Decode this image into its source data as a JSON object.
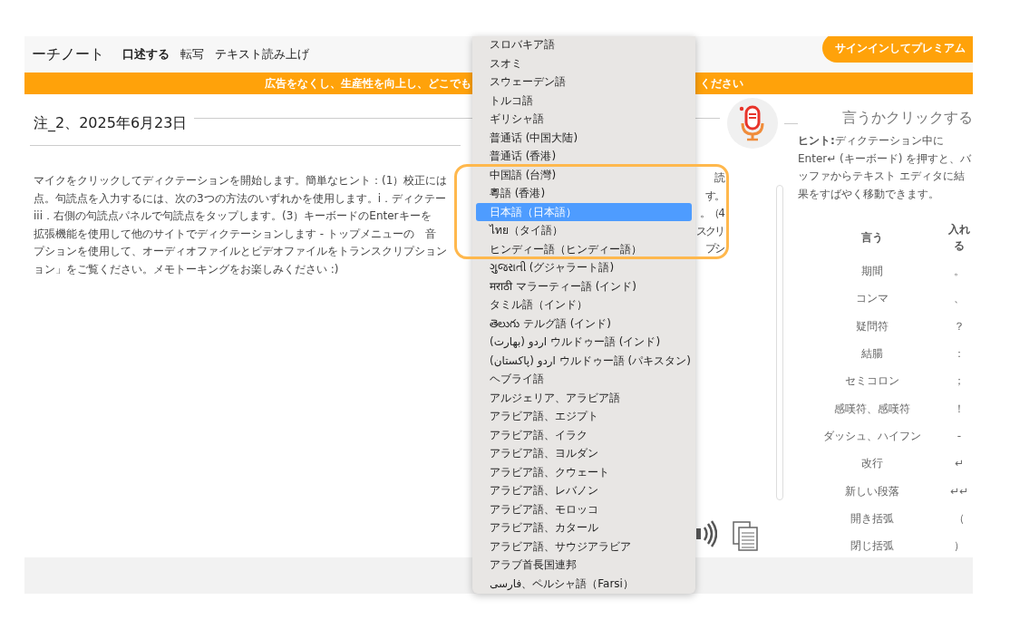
{
  "app_nav": {
    "brand": "ーチノート",
    "tabs": [
      {
        "label": "口述する",
        "selected": true
      },
      {
        "label": "転写",
        "selected": false
      },
      {
        "label": "テキスト読み上げ",
        "selected": false
      }
    ],
    "signin_button": "サインインしてプレミアム"
  },
  "banner": {
    "text_left": "広告をなくし、生産性を向上し、どこでも",
    "text_right": "ください"
  },
  "note": {
    "title": "注_2、2025年6月23日",
    "text_lines": [
      {
        "left": "マイクをクリックしてディクテーションを開始します。簡単なヒント：(1）校正には",
        "right": "読"
      },
      {
        "left": "点。句読点を入力するには、次の3つの方法のいずれかを使用します。i．ディクテー",
        "right": "す。"
      },
      {
        "left": "iii．右側の句読点パネルで句読点をタップします。(3）キーボードのEnterキーを",
        "right": "。（4"
      },
      {
        "left": "拡張機能を使用して他のサイトでディクテーションします - トップメニューの　音",
        "right": "スクリ"
      },
      {
        "left": "プションを使用して、オーディオファイルとビデオファイルをトランスクリプション",
        "right": "プシ"
      },
      {
        "left": "ョン」をご覧ください。メモトーキングをお楽しみください :)"
      }
    ]
  },
  "dictation_panel": {
    "heading": "言うかクリックする",
    "hint": "**ヒント:**ディクテーション中にEnter↵ (キーボード) を押すと、バッファからテキスト エディタに結果をすばやく移動できます。",
    "table": {
      "columns": [
        "言う",
        "入れる"
      ],
      "rows": [
        [
          "期間",
          "。"
        ],
        [
          "コンマ",
          "、"
        ],
        [
          "疑問符",
          "？"
        ],
        [
          "結腸",
          "："
        ],
        [
          "セミコロン",
          "；"
        ],
        [
          "感嘆符、感嘆符",
          "！"
        ],
        [
          "ダッシュ、ハイフン",
          "-"
        ],
        [
          "改行",
          "↵"
        ],
        [
          "新しい段落",
          "↵↵"
        ],
        [
          "開き括弧",
          "（"
        ],
        [
          "閉じ括弧",
          "）"
        ]
      ]
    }
  },
  "language_menu": {
    "items": [
      {
        "label": "スロバキア語",
        "selected": false
      },
      {
        "label": "スオミ",
        "selected": false
      },
      {
        "label": "スウェーデン語",
        "selected": false
      },
      {
        "label": "トルコ語",
        "selected": false
      },
      {
        "label": "ギリシャ語",
        "selected": false
      },
      {
        "label": "普通话 (中国大陆)",
        "selected": false
      },
      {
        "label": "普通话 (香港)",
        "selected": false
      },
      {
        "label": "中国語 (台灣)",
        "selected": false
      },
      {
        "label": "粵語 (香港)",
        "selected": false
      },
      {
        "label": "日本語（日本語）",
        "selected": true
      },
      {
        "label": "ไทย（タイ語）",
        "selected": false
      },
      {
        "label": "ヒンディー語（ヒンディー語）",
        "selected": false
      },
      {
        "label": "ગુજરાતી (グジャラート語)",
        "selected": false
      },
      {
        "label": "मराठी マラーティー語 (インド)",
        "selected": false
      },
      {
        "label": "タミル語（インド）",
        "selected": false
      },
      {
        "label": "తెలుగు テルグ語 (インド)",
        "selected": false
      },
      {
        "label": "اردو (بھارت) ウルドゥー語 (インド)",
        "selected": false
      },
      {
        "label": "اردو (پاکستان) ウルドゥー語 (パキスタン)",
        "selected": false
      },
      {
        "label": "ヘブライ語",
        "selected": false
      },
      {
        "label": "アルジェリア、アラビア語",
        "selected": false
      },
      {
        "label": "アラビア語、エジプト",
        "selected": false
      },
      {
        "label": "アラビア語、イラク",
        "selected": false
      },
      {
        "label": "アラビア語、ヨルダン",
        "selected": false
      },
      {
        "label": "アラビア語、クウェート",
        "selected": false
      },
      {
        "label": "アラビア語、レバノン",
        "selected": false
      },
      {
        "label": "アラビア語、モロッコ",
        "selected": false
      },
      {
        "label": "アラビア語、カタール",
        "selected": false
      },
      {
        "label": "アラビア語、サウジアラビア",
        "selected": false
      },
      {
        "label": "アラブ首長国連邦",
        "selected": false
      },
      {
        "label": "فارسی、ペルシャ語（Farsi）",
        "selected": false
      }
    ]
  }
}
